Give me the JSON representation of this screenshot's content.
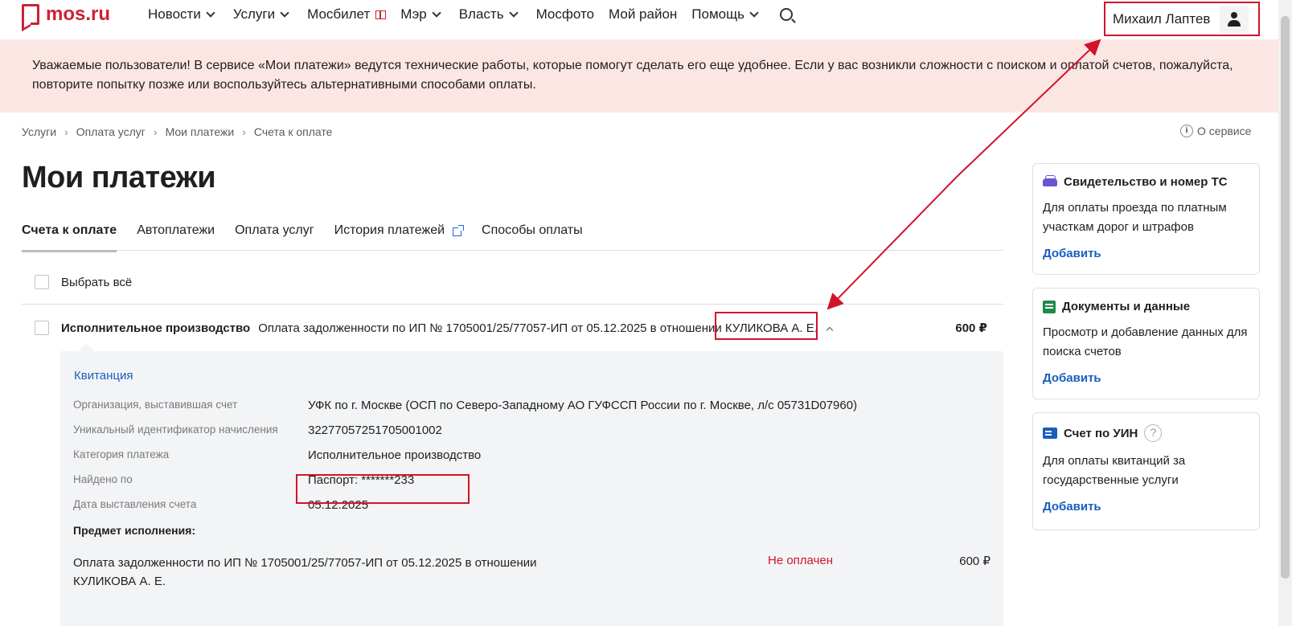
{
  "header": {
    "logo_text": "mos.ru",
    "nav": [
      {
        "label": "Новости",
        "has_chevron": true
      },
      {
        "label": "Услуги",
        "has_chevron": true
      },
      {
        "label": "Мосбилет",
        "has_chevron": false
      },
      {
        "label": "Мэр",
        "has_chevron": true
      },
      {
        "label": "Власть",
        "has_chevron": true
      },
      {
        "label": "Мосфото",
        "has_chevron": false
      },
      {
        "label": "Мой район",
        "has_chevron": false
      },
      {
        "label": "Помощь",
        "has_chevron": true
      }
    ],
    "user_name": "Михаил Лаптев"
  },
  "banner": {
    "text": "Уважаемые пользователи! В сервисе «Мои платежи» ведутся технические работы, которые помогут сделать его еще удобнее. Если у вас возникли сложности с поиском и оплатой счетов, пожалуйста, повторите попытку позже или воспользуйтесь альтернативными способами оплаты."
  },
  "breadcrumb": [
    "Услуги",
    "Оплата услуг",
    "Мои платежи",
    "Счета к оплате"
  ],
  "about_service": "О сервисе",
  "page_title": "Мои платежи",
  "tabs": [
    {
      "label": "Счета к оплате",
      "active": true
    },
    {
      "label": "Автоплатежи",
      "active": false
    },
    {
      "label": "Оплата услуг",
      "active": false
    },
    {
      "label": "История платежей",
      "active": false,
      "external": true
    },
    {
      "label": "Способы оплаты",
      "active": false
    }
  ],
  "select_all": "Выбрать всё",
  "bill": {
    "category": "Исполнительное производство",
    "description": "Оплата задолженности по ИП № 1705001/25/77057-ИП от 05.12.2025 в отношении КУЛИКОВА А. Е.",
    "amount": "600 ₽",
    "receipt_link": "Квитанция",
    "details": [
      {
        "label": "Организация, выставившая счет",
        "value": "УФК по г. Москве (ОСП по Северо-Западному АО ГУФССП России по г. Москве, л/с 05731D07960)"
      },
      {
        "label": "Уникальный идентификатор начисления",
        "value": "32277057251705001002"
      },
      {
        "label": "Категория платежа",
        "value": "Исполнительное производство"
      },
      {
        "label": "Найдено по",
        "value": "Паспорт: *******233"
      },
      {
        "label": "Дата выставления счета",
        "value": "05.12.2025"
      }
    ],
    "subject_title": "Предмет исполнения:",
    "subject_text": "Оплата задолженности по ИП № 1705001/25/77057-ИП от 05.12.2025 в отношении КУЛИКОВА А. Е.",
    "status": "Не оплачен",
    "subject_amount": "600 ₽"
  },
  "cards": [
    {
      "icon": "car-icon",
      "title": "Свидетельство и номер ТС",
      "text": "Для оплаты проезда по платным участкам дорог и штрафов",
      "link": "Добавить"
    },
    {
      "icon": "documents-icon",
      "title": "Документы и данные",
      "text": "Просмотр и добавление данных для поиска счетов",
      "link": "Добавить"
    },
    {
      "icon": "id-card-icon",
      "title": "Счет по УИН",
      "text": "Для оплаты квитанций за государственные услуги",
      "link": "Добавить"
    }
  ],
  "colors": {
    "brand": "#cc2233",
    "link": "#1a5ebd",
    "annotation": "#d0142b",
    "banner_bg": "#fce6e4"
  }
}
